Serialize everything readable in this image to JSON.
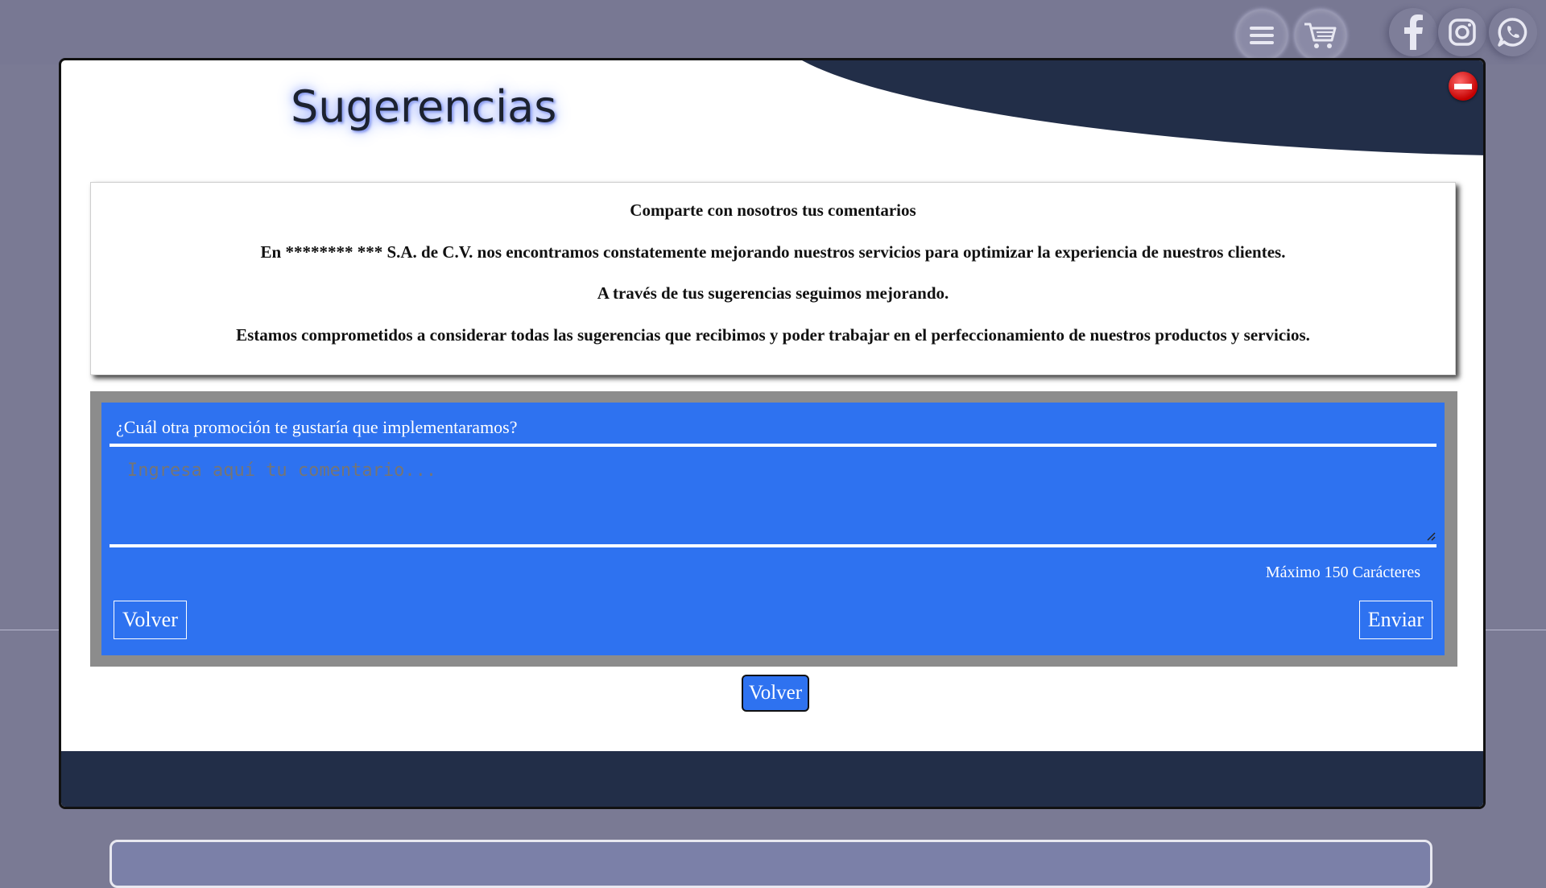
{
  "topbar": {
    "icons": [
      "menu-icon",
      "cart-icon",
      "facebook-icon",
      "instagram-icon",
      "whatsapp-icon"
    ]
  },
  "modal": {
    "title": "Sugerencias",
    "close_icon": "close-icon",
    "info": {
      "heading": "Comparte con nosotros tus comentarios",
      "line1": "En ******** *** S.A. de C.V. nos encontramos constatemente mejorando nuestros servicios para optimizar la experiencia de nuestros clientes.",
      "line2": "A través de tus sugerencias seguimos mejorando.",
      "line3": "Estamos comprometidos a considerar todas las sugerencias que recibimos y poder trabajar en el perfeccionamiento de nuestros productos y servicios."
    },
    "form": {
      "question": "¿Cuál otra promoción te gustaría que implementaramos?",
      "comment_value": "",
      "comment_placeholder": "Ingresa aquí tu comentario...",
      "max_chars_label": "Máximo 150 Carácteres",
      "back_label": "Volver",
      "send_label": "Enviar"
    },
    "back_main_label": "Volver"
  },
  "colors": {
    "accent_blue": "#2e72f0",
    "navy": "#222e48",
    "background": "#7a7a94",
    "close_red": "#c40000"
  }
}
